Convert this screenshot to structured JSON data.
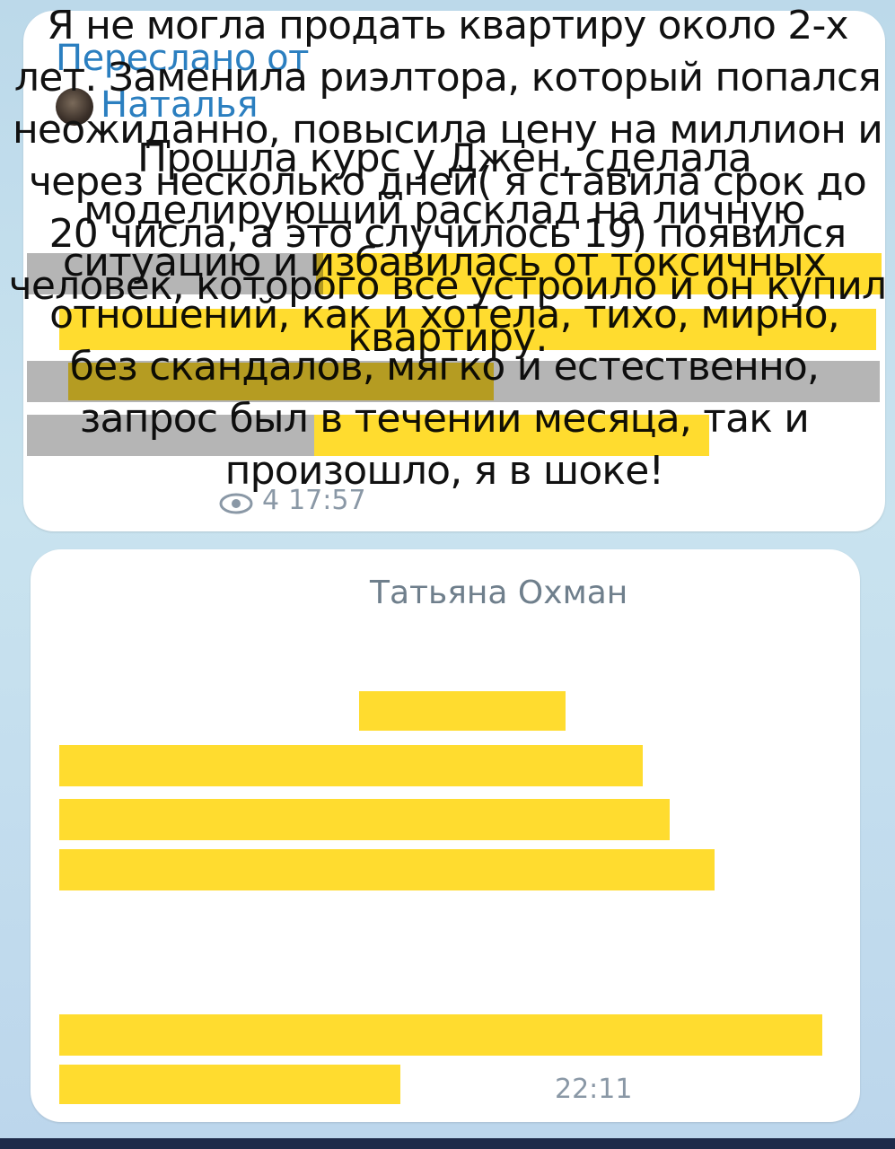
{
  "message1": {
    "forwarded_label": "Переслано от",
    "forwarded_name": "Наталья",
    "text": "Прошла курс у Джен, сделала моделирующий расклад на личную ситуацию и избавилась от токсичных отношений, как и хотела, тихо, мирно, без скандалов, мягко и естественно, запрос был в течении месяца, так и произошло, я в шоке!",
    "views": "4",
    "time": "17:57"
  },
  "message2": {
    "sender": "Татьяна Охман",
    "text": "Я не могла продать квартиру около 2-х лет. Заменила риэлтора, который попался неожиданно, повысила цену на миллион и через несколько дней( я ставила срок до 20 числа, а это случилось 19) появился человек, которого все устроило и он купил квартиру.",
    "time": "22:11"
  },
  "colors": {
    "accent": "#2b7fc0",
    "highlight": "#ffd60a",
    "bubble": "#ffffff",
    "background": "#c9e3ef",
    "meta": "#8a98a6"
  },
  "icons": {
    "views": "eye-icon",
    "avatar": "avatar-photo"
  }
}
